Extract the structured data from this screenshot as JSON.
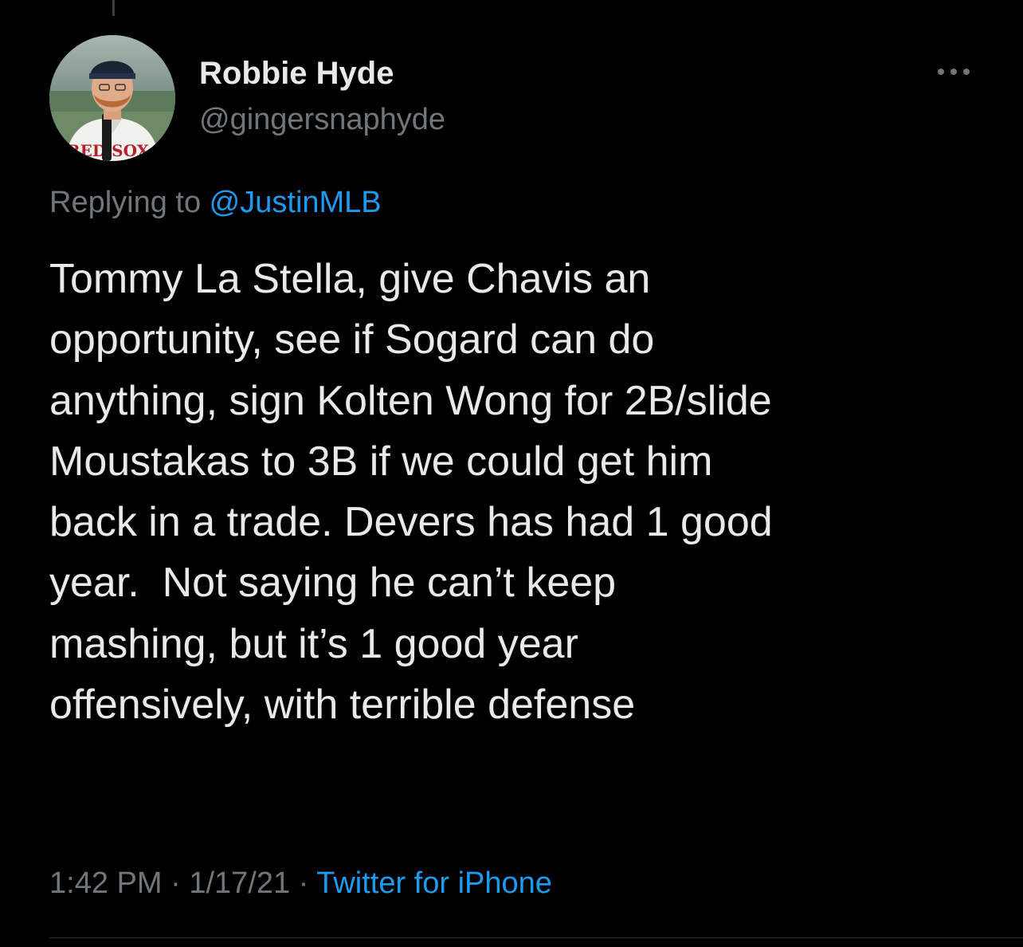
{
  "tweet": {
    "author": {
      "display_name": "Robbie Hyde",
      "handle": "@gingersnaphyde",
      "avatar_jersey_text": "RED SOX"
    },
    "reply": {
      "prefix": "Replying to ",
      "mention": "@JustinMLB"
    },
    "text": "Tommy La Stella, give Chavis an\nopportunity, see if Sogard can do\nanything, sign Kolten Wong for 2B/slide\nMoustakas to 3B if we could get him\nback in a trade. Devers has had 1 good\nyear.  Not saying he can’t keep\nmashing, but it’s 1 good year\noffensively, with terrible defense",
    "time": "1:42 PM",
    "separator": " · ",
    "date": "1/17/21",
    "source": "Twitter for iPhone",
    "more_icon": "ellipsis-icon"
  },
  "colors": {
    "background": "#000000",
    "primary_text": "#e7e9ea",
    "secondary_text": "#71767b",
    "link": "#1d9bf0"
  }
}
